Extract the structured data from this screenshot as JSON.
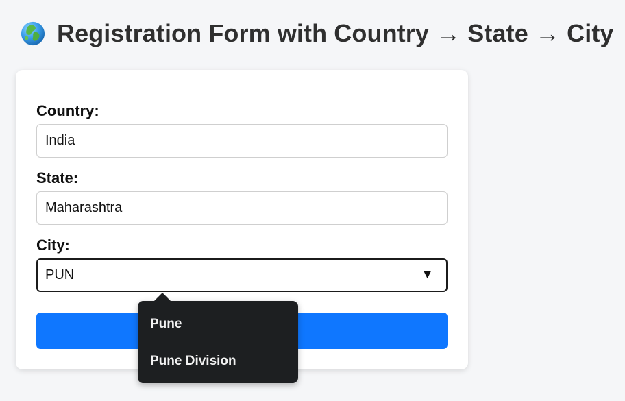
{
  "header": {
    "title": "Registration Form with Country → State → City",
    "globe_icon": "globe-icon"
  },
  "form": {
    "country": {
      "label": "Country:",
      "value": "India"
    },
    "state": {
      "label": "State:",
      "value": "Maharashtra"
    },
    "city": {
      "label": "City:",
      "value": "PUN",
      "arrow_icon": "dropdown-arrow-icon"
    }
  },
  "autocomplete": {
    "options": [
      {
        "label": "Pune"
      },
      {
        "label": "Pune Division"
      }
    ]
  },
  "colors": {
    "page_background": "#f5f6f8",
    "card_background": "#ffffff",
    "button_blue": "#0f77ff",
    "popup_background": "#1d1f21",
    "title_text": "#2f2f2f"
  }
}
